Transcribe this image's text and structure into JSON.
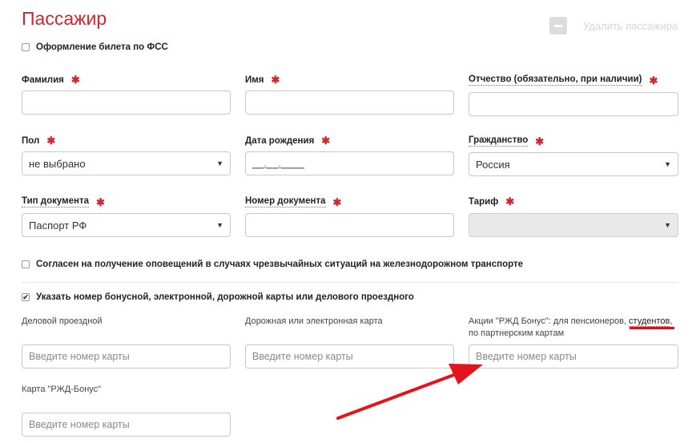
{
  "title": "Пассажир",
  "remove": {
    "label": "Удалить пассажира",
    "icon": "minus-icon"
  },
  "fss": {
    "label": "Оформление билета по ФСС",
    "checked": false
  },
  "fields": {
    "surname": {
      "label": "Фамилия",
      "value": ""
    },
    "name": {
      "label": "Имя",
      "value": ""
    },
    "patronymic": {
      "label": "Отчество (обязательно, при наличии)",
      "value": ""
    },
    "gender": {
      "label": "Пол",
      "value": "не выбрано"
    },
    "birthdate": {
      "label": "Дата рождения",
      "mask": "__.__.____"
    },
    "citizenship": {
      "label": "Гражданство",
      "value": "Россия"
    },
    "doc_type": {
      "label": "Тип документа",
      "value": "Паспорт РФ"
    },
    "doc_number": {
      "label": "Номер документа",
      "value": ""
    },
    "tariff": {
      "label": "Тариф",
      "value": ""
    }
  },
  "required_mark": "✱",
  "consent": {
    "label": "Согласен на получение оповещений в случаях чрезвычайных ситуаций на железнодорожном транспорте",
    "checked": false
  },
  "bonus": {
    "label": "Указать номер бонусной, электронной, дорожной карты или делового проездного",
    "checked": true,
    "check_glyph": "✔",
    "business_pass": {
      "label": "Деловой проездной",
      "placeholder": "Введите номер карты"
    },
    "road_card": {
      "label": "Дорожная или электронная карта",
      "placeholder": "Введите номер карты"
    },
    "promo": {
      "label_part1": "Акции \"РЖД Бонус\": для пенсионеров,",
      "label_link": "студентов",
      "label_part2": ",",
      "label_line2": "по партнерским картам",
      "placeholder": "Введите номер карты"
    },
    "rzd_bonus": {
      "label": "Карта \"РЖД-Бонус\"",
      "placeholder": "Введите номер карты"
    }
  },
  "annotation": {
    "arrow_color": "#e3141c",
    "underline_color": "#d8121a"
  },
  "colors": {
    "accent": "#d0262c"
  }
}
